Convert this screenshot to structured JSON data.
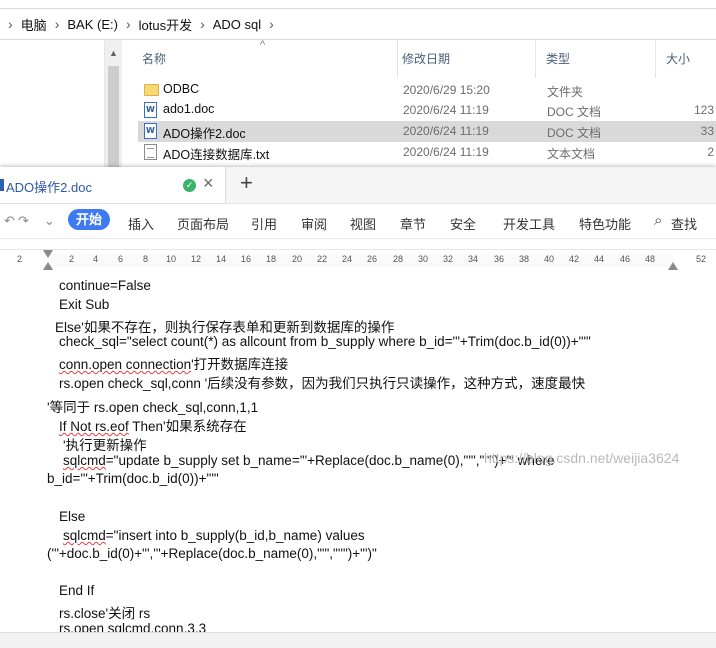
{
  "explorer": {
    "breadcrumb": [
      "电脑",
      "BAK (E:)",
      "lotus开发",
      "ADO sql"
    ],
    "columns": {
      "name": "名称",
      "date": "修改日期",
      "type": "类型",
      "size": "大小"
    },
    "files": [
      {
        "name": "ODBC",
        "date": "2020/6/29 15:20",
        "type": "文件夹",
        "size": "",
        "icon": "folder-icon"
      },
      {
        "name": "ado1.doc",
        "date": "2020/6/24 11:19",
        "type": "DOC 文档",
        "size": "123",
        "icon": "doc-file-icon"
      },
      {
        "name": "ADO操作2.doc",
        "date": "2020/6/24 11:19",
        "type": "DOC 文档",
        "size": "33",
        "icon": "doc-file-icon",
        "selected": true
      },
      {
        "name": "ADO连接数据库.txt",
        "date": "2020/6/24 11:19",
        "type": "文本文档",
        "size": "2",
        "icon": "txt-file-icon"
      }
    ]
  },
  "wps": {
    "tab_title": "ADO操作2.doc",
    "new_tab": "+",
    "ribbon": {
      "start": "开始",
      "insert": "插入",
      "layout": "页面布局",
      "reference": "引用",
      "review": "审阅",
      "view": "视图",
      "section": "章节",
      "security": "安全",
      "devtools": "开发工具",
      "features": "特色功能",
      "search": "查找"
    },
    "ruler": [
      "2",
      "2",
      "2",
      "4",
      "6",
      "8",
      "10",
      "12",
      "14",
      "16",
      "18",
      "20",
      "22",
      "24",
      "26",
      "28",
      "30",
      "32",
      "34",
      "36",
      "38",
      "40",
      "42",
      "44",
      "46",
      "48",
      "52"
    ],
    "doc_lines": {
      "l1": "continue=False",
      "l2": "Exit Sub",
      "l3": "Else'如果不存在，则执行保存表单和更新到数据库的操作",
      "l4": "check_sql=\"select count(*) as allcount from b_supply where b_id='\"+Trim(doc.b_id(0))+\"'\"",
      "l5a": "conn.open connection",
      "l5b": "'打开数据库连接",
      "l6": "rs.open check_sql,conn '后续没有参数，因为我们只执行只读操作，这种方式，速度最快",
      "l7": "'等同于 rs.open check_sql,conn,1,1",
      "l8a": "If Not rs.eof",
      "l8b": " Then'如果系统存在",
      "l9": "'执行更新操作",
      "l10a": "sqlcmd",
      "l10b": "=\"update b_supply set b_name='\"+Replace(doc.b_name(0),\"'\",\"''\")+\"' where",
      "l11": "b_id='\"+Trim(doc.b_id(0))+\"'\"",
      "l12": "Else",
      "l13a": "sqlcmd",
      "l13b": "=\"insert into b_supply(b_id,b_name) values",
      "l14": "('\"+doc.b_id(0)+\"','\"+Replace(doc.b_name(0),\"'\",\"''\")+\"')\"",
      "l15": "End If",
      "l16": "rs.close'关闭 rs",
      "l17": "rs.open sqlcmd,conn,3,3"
    },
    "watermark": "https://blog.csdn.net/weijia3624"
  }
}
